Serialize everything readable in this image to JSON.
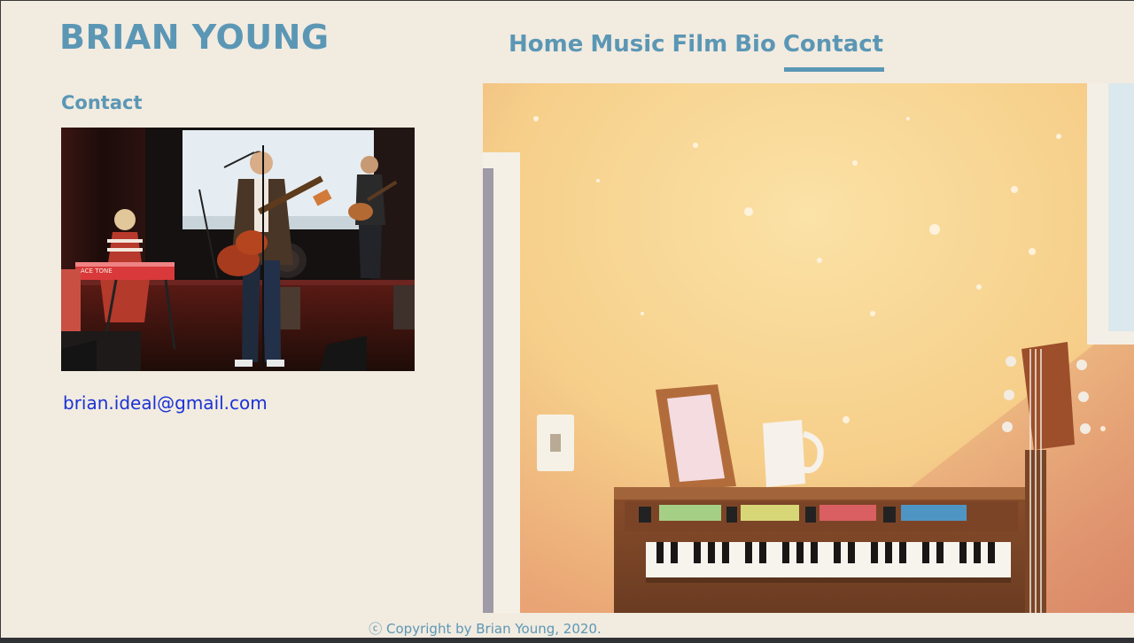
{
  "site": {
    "title": "BRIAN YOUNG"
  },
  "nav": {
    "items": [
      {
        "label": "Home"
      },
      {
        "label": "Music"
      },
      {
        "label": "Film"
      },
      {
        "label": "Bio"
      },
      {
        "label": "Contact",
        "active": true
      }
    ]
  },
  "contact": {
    "heading": "Contact",
    "email": "brian.ideal@gmail.com"
  },
  "band_photo": {
    "amp_label": "ACE TONE"
  },
  "footer": {
    "copyright": "ⓒ Copyright by Brian Young, 2020."
  },
  "colors": {
    "background": "#f2ebe0",
    "brand": "#5b97b5",
    "link": "#1a33d6"
  }
}
